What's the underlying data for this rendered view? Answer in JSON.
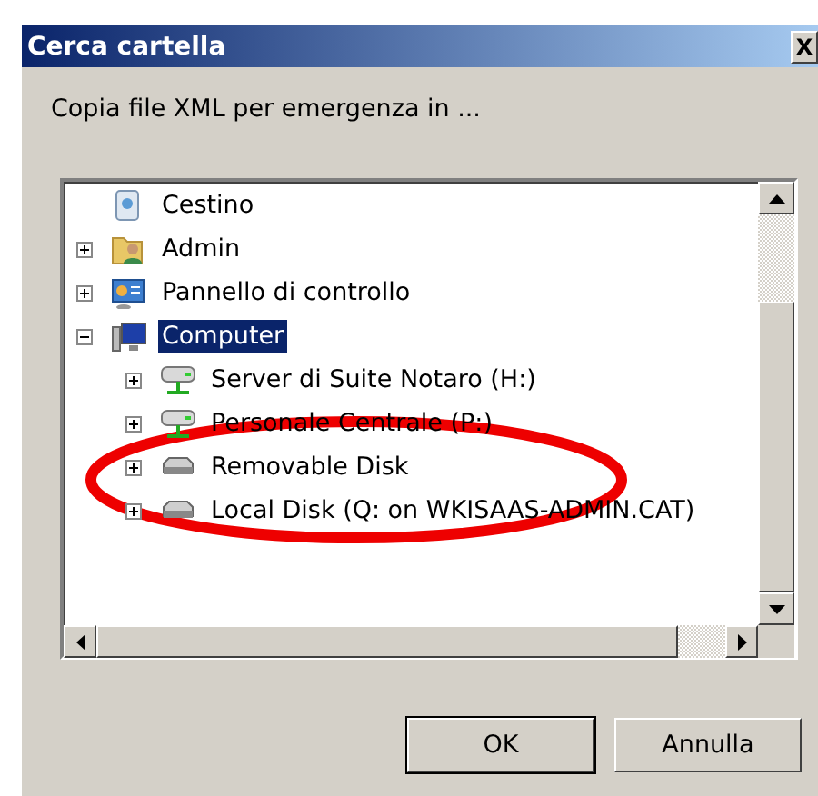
{
  "window": {
    "title": "Cerca cartella",
    "close": "X"
  },
  "prompt": "Copia file XML per emergenza in ...",
  "tree": [
    {
      "label": "Cestino",
      "kind": "bin",
      "expandable": false,
      "selected": false
    },
    {
      "label": "Admin",
      "kind": "userfolder",
      "expandable": true,
      "expanded": false,
      "selected": false
    },
    {
      "label": "Pannello di controllo",
      "kind": "panel",
      "expandable": true,
      "expanded": false,
      "selected": false
    },
    {
      "label": "Computer",
      "kind": "computer",
      "expandable": true,
      "expanded": true,
      "selected": true,
      "children": [
        {
          "label": "Server di Suite Notaro (H:)",
          "kind": "netdrive",
          "expandable": true,
          "expanded": false,
          "selected": false
        },
        {
          "label": "Personale Centrale (P:)",
          "kind": "netdrive",
          "expandable": true,
          "expanded": false,
          "selected": false
        },
        {
          "label": "Removable Disk",
          "kind": "drive",
          "expandable": true,
          "expanded": false,
          "selected": false
        },
        {
          "label": "Local Disk (Q: on WKISAAS-ADMIN.CAT)",
          "kind": "drive",
          "expandable": true,
          "expanded": false,
          "selected": false
        }
      ]
    }
  ],
  "buttons": [
    "OK",
    "Annulla"
  ]
}
